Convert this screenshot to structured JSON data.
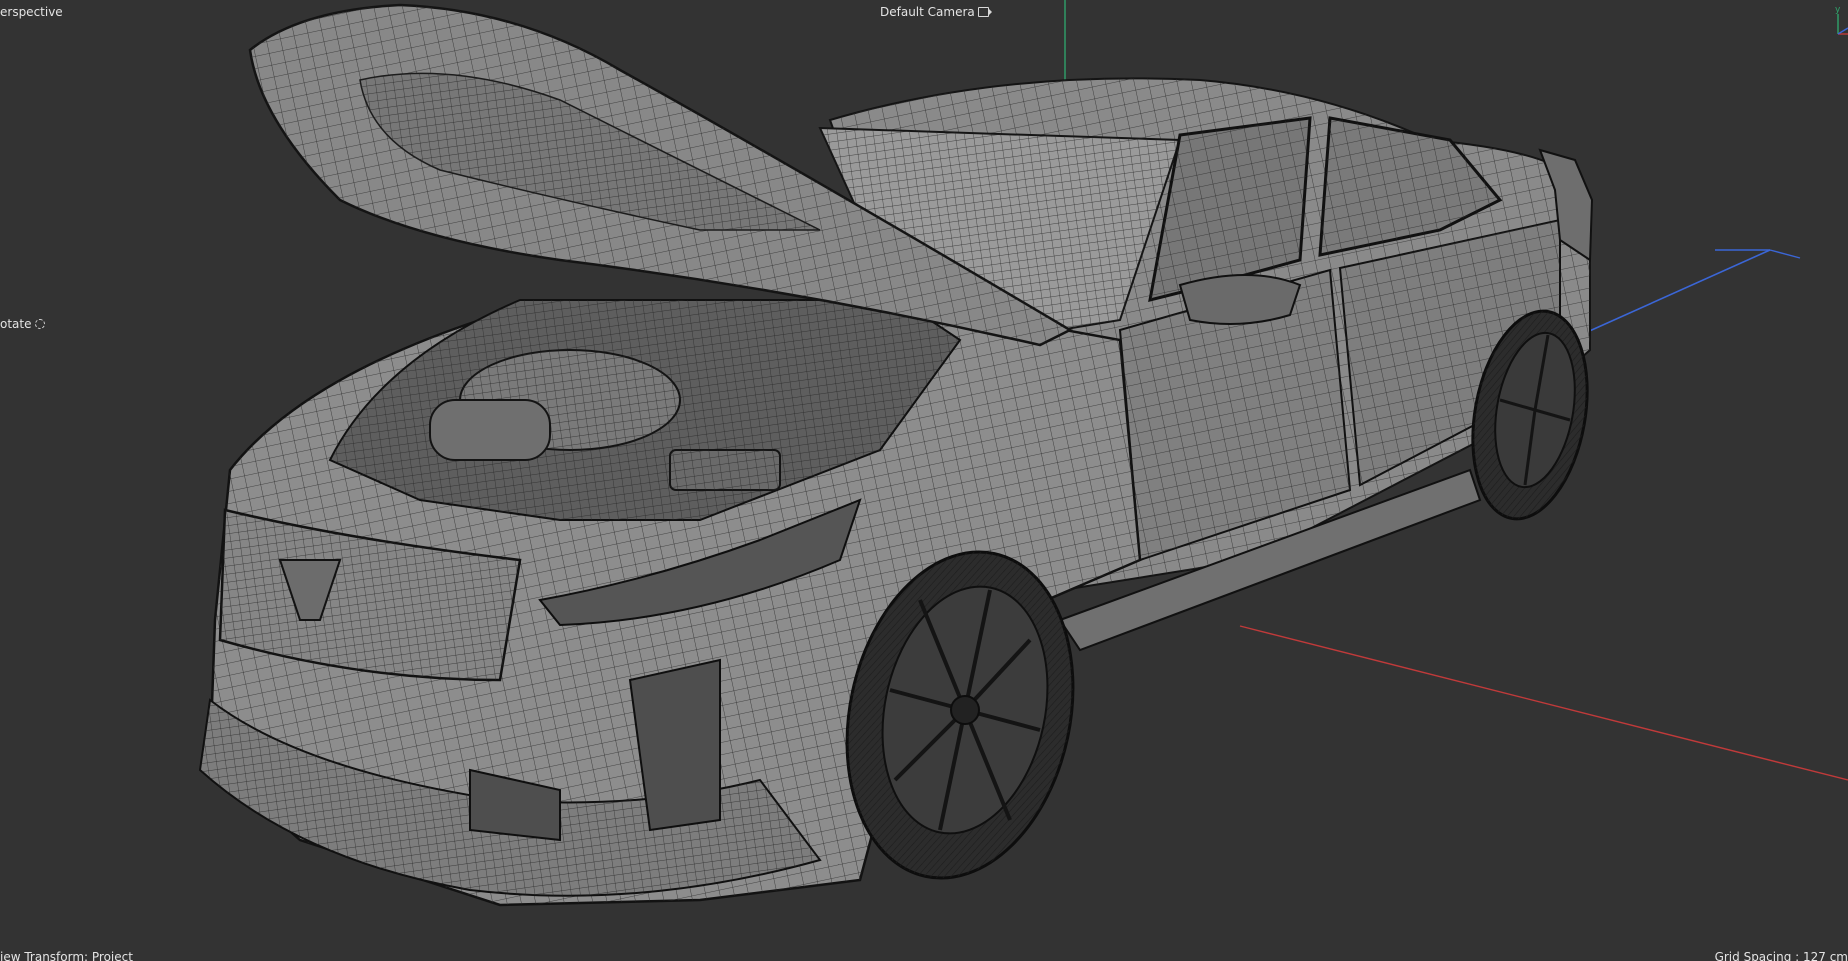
{
  "viewport": {
    "view_name": "erspective",
    "camera_name": "Default Camera",
    "camera_icon": "camera-link-icon",
    "rotate_label": "otate",
    "rotate_icon": "rotate-icon",
    "view_transform": "iew Transform: Project",
    "grid_spacing": "Grid Spacing : 127 cm",
    "background_color": "#333333",
    "model": "car-wireframe-model",
    "axis_colors": {
      "x": "#c03a3a",
      "y": "#2fa36b",
      "z": "#3b66d6"
    }
  }
}
